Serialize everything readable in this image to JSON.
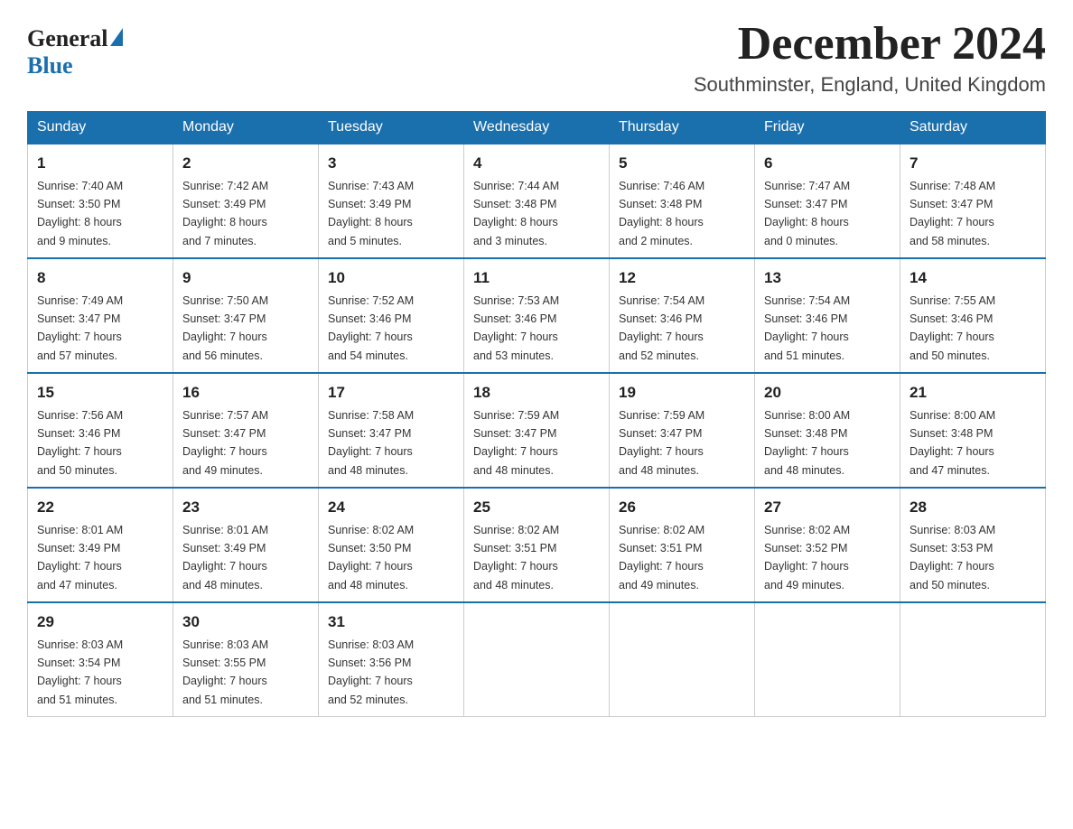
{
  "logo": {
    "general": "General",
    "blue": "Blue"
  },
  "header": {
    "month": "December 2024",
    "location": "Southminster, England, United Kingdom"
  },
  "days_of_week": [
    "Sunday",
    "Monday",
    "Tuesday",
    "Wednesday",
    "Thursday",
    "Friday",
    "Saturday"
  ],
  "weeks": [
    [
      {
        "day": "1",
        "sunrise": "7:40 AM",
        "sunset": "3:50 PM",
        "daylight": "8 hours and 9 minutes."
      },
      {
        "day": "2",
        "sunrise": "7:42 AM",
        "sunset": "3:49 PM",
        "daylight": "8 hours and 7 minutes."
      },
      {
        "day": "3",
        "sunrise": "7:43 AM",
        "sunset": "3:49 PM",
        "daylight": "8 hours and 5 minutes."
      },
      {
        "day": "4",
        "sunrise": "7:44 AM",
        "sunset": "3:48 PM",
        "daylight": "8 hours and 3 minutes."
      },
      {
        "day": "5",
        "sunrise": "7:46 AM",
        "sunset": "3:48 PM",
        "daylight": "8 hours and 2 minutes."
      },
      {
        "day": "6",
        "sunrise": "7:47 AM",
        "sunset": "3:47 PM",
        "daylight": "8 hours and 0 minutes."
      },
      {
        "day": "7",
        "sunrise": "7:48 AM",
        "sunset": "3:47 PM",
        "daylight": "7 hours and 58 minutes."
      }
    ],
    [
      {
        "day": "8",
        "sunrise": "7:49 AM",
        "sunset": "3:47 PM",
        "daylight": "7 hours and 57 minutes."
      },
      {
        "day": "9",
        "sunrise": "7:50 AM",
        "sunset": "3:47 PM",
        "daylight": "7 hours and 56 minutes."
      },
      {
        "day": "10",
        "sunrise": "7:52 AM",
        "sunset": "3:46 PM",
        "daylight": "7 hours and 54 minutes."
      },
      {
        "day": "11",
        "sunrise": "7:53 AM",
        "sunset": "3:46 PM",
        "daylight": "7 hours and 53 minutes."
      },
      {
        "day": "12",
        "sunrise": "7:54 AM",
        "sunset": "3:46 PM",
        "daylight": "7 hours and 52 minutes."
      },
      {
        "day": "13",
        "sunrise": "7:54 AM",
        "sunset": "3:46 PM",
        "daylight": "7 hours and 51 minutes."
      },
      {
        "day": "14",
        "sunrise": "7:55 AM",
        "sunset": "3:46 PM",
        "daylight": "7 hours and 50 minutes."
      }
    ],
    [
      {
        "day": "15",
        "sunrise": "7:56 AM",
        "sunset": "3:46 PM",
        "daylight": "7 hours and 50 minutes."
      },
      {
        "day": "16",
        "sunrise": "7:57 AM",
        "sunset": "3:47 PM",
        "daylight": "7 hours and 49 minutes."
      },
      {
        "day": "17",
        "sunrise": "7:58 AM",
        "sunset": "3:47 PM",
        "daylight": "7 hours and 48 minutes."
      },
      {
        "day": "18",
        "sunrise": "7:59 AM",
        "sunset": "3:47 PM",
        "daylight": "7 hours and 48 minutes."
      },
      {
        "day": "19",
        "sunrise": "7:59 AM",
        "sunset": "3:47 PM",
        "daylight": "7 hours and 48 minutes."
      },
      {
        "day": "20",
        "sunrise": "8:00 AM",
        "sunset": "3:48 PM",
        "daylight": "7 hours and 48 minutes."
      },
      {
        "day": "21",
        "sunrise": "8:00 AM",
        "sunset": "3:48 PM",
        "daylight": "7 hours and 47 minutes."
      }
    ],
    [
      {
        "day": "22",
        "sunrise": "8:01 AM",
        "sunset": "3:49 PM",
        "daylight": "7 hours and 47 minutes."
      },
      {
        "day": "23",
        "sunrise": "8:01 AM",
        "sunset": "3:49 PM",
        "daylight": "7 hours and 48 minutes."
      },
      {
        "day": "24",
        "sunrise": "8:02 AM",
        "sunset": "3:50 PM",
        "daylight": "7 hours and 48 minutes."
      },
      {
        "day": "25",
        "sunrise": "8:02 AM",
        "sunset": "3:51 PM",
        "daylight": "7 hours and 48 minutes."
      },
      {
        "day": "26",
        "sunrise": "8:02 AM",
        "sunset": "3:51 PM",
        "daylight": "7 hours and 49 minutes."
      },
      {
        "day": "27",
        "sunrise": "8:02 AM",
        "sunset": "3:52 PM",
        "daylight": "7 hours and 49 minutes."
      },
      {
        "day": "28",
        "sunrise": "8:03 AM",
        "sunset": "3:53 PM",
        "daylight": "7 hours and 50 minutes."
      }
    ],
    [
      {
        "day": "29",
        "sunrise": "8:03 AM",
        "sunset": "3:54 PM",
        "daylight": "7 hours and 51 minutes."
      },
      {
        "day": "30",
        "sunrise": "8:03 AM",
        "sunset": "3:55 PM",
        "daylight": "7 hours and 51 minutes."
      },
      {
        "day": "31",
        "sunrise": "8:03 AM",
        "sunset": "3:56 PM",
        "daylight": "7 hours and 52 minutes."
      },
      null,
      null,
      null,
      null
    ]
  ],
  "labels": {
    "sunrise": "Sunrise:",
    "sunset": "Sunset:",
    "daylight": "Daylight:"
  }
}
